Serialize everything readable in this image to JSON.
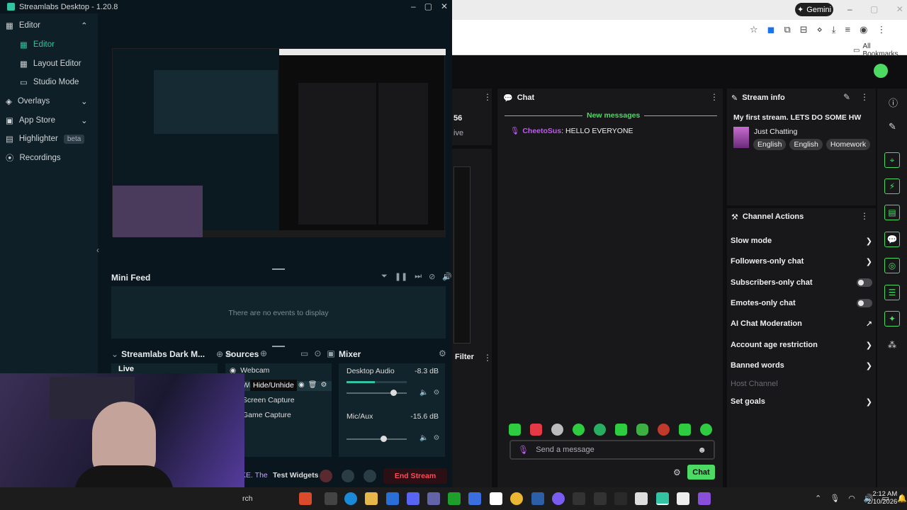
{
  "streamlabs": {
    "title": "Streamlabs Desktop - 1.20.8",
    "sidebar": {
      "items": [
        {
          "label": "Editor",
          "level": 0,
          "active": false,
          "chevron": "up"
        },
        {
          "label": "Editor",
          "level": 1,
          "active": true
        },
        {
          "label": "Layout Editor",
          "level": 1
        },
        {
          "label": "Studio Mode",
          "level": 1
        },
        {
          "label": "Overlays",
          "level": 0,
          "chevron": "down"
        },
        {
          "label": "App Store",
          "level": 0,
          "chevron": "down"
        },
        {
          "label": "Highlighter",
          "level": 0,
          "badge": "beta"
        },
        {
          "label": "Recordings",
          "level": 0
        }
      ]
    },
    "mini_feed": {
      "title": "Mini Feed",
      "empty_text": "There are no events to display"
    },
    "scenes": {
      "title": "Streamlabs Dark M...",
      "items": [
        "Live"
      ]
    },
    "sources": {
      "title": "Sources",
      "items": [
        "Webcam",
        "Wi",
        "Screen Capture",
        "Game Capture"
      ],
      "tooltip": "Hide/Unhide"
    },
    "mixer": {
      "title": "Mixer",
      "channels": [
        {
          "name": "Desktop Audio",
          "level": "-8.3 dB",
          "volume": 0.78
        },
        {
          "name": "Mic/Aux",
          "level": "-15.6 dB",
          "volume": 0.6
        }
      ]
    },
    "footer": {
      "ticker": "KE. The",
      "test_widgets": "Test Widgets",
      "end_stream": "End Stream"
    }
  },
  "browser": {
    "gemini_label": "Gemini",
    "bookmarks_label": "All Bookmarks"
  },
  "dashboard": {
    "partial_stat": "56",
    "partial_live": "ive",
    "filter_label": "Filter",
    "chat": {
      "title": "Chat",
      "new_messages": "New messages",
      "messages": [
        {
          "user": "CheetoSus",
          "text": ": HELLO EVERYONE"
        }
      ],
      "input_placeholder": "Send a message",
      "send_label": "Chat"
    },
    "stream_info": {
      "title": "Stream info",
      "stream_title": "My first stream. LETS DO SOME HW",
      "category": "Just Chatting",
      "tags": [
        "English",
        "English",
        "Homework"
      ]
    },
    "channel_actions": {
      "title": "Channel Actions",
      "items": [
        {
          "label": "Slow mode",
          "control": "chevron"
        },
        {
          "label": "Followers-only chat",
          "control": "chevron"
        },
        {
          "label": "Subscribers-only chat",
          "control": "toggle"
        },
        {
          "label": "Emotes-only chat",
          "control": "toggle"
        },
        {
          "label": "AI Chat Moderation",
          "control": "external"
        },
        {
          "label": "Account age restriction",
          "control": "chevron"
        },
        {
          "label": "Banned words",
          "control": "chevron"
        },
        {
          "label": "Host Channel",
          "control": "none",
          "disabled": true
        },
        {
          "label": "Set goals",
          "control": "chevron"
        }
      ]
    }
  },
  "taskbar": {
    "search_fragment": "rch",
    "time": "2:12 AM",
    "date": "2/10/2026"
  },
  "colors": {
    "twitch_green": "#4cd964",
    "streamlabs_teal": "#31c3a2",
    "end_stream_red": "#ff4a5a",
    "username_green": "#a86cf3"
  }
}
